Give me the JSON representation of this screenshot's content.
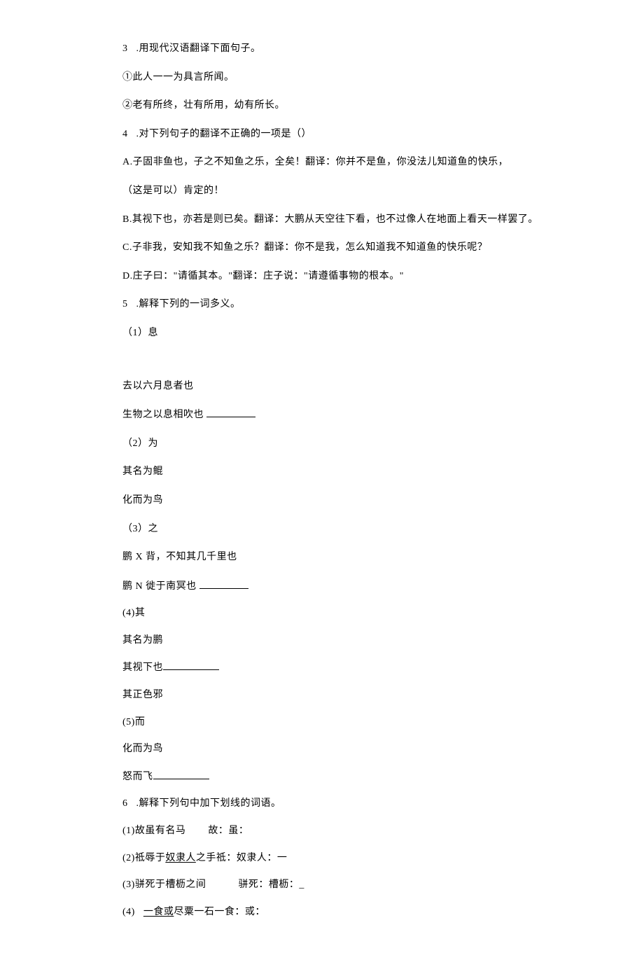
{
  "q3": {
    "num": "3",
    "prefix": ".用现代汉语翻译下面句子。",
    "line1": "①此人一一为具言所闻。",
    "line2": "②老有所终，壮有所用，幼有所长。"
  },
  "q4": {
    "num": "4",
    "prefix": ".对下列句子的翻译不正确的一项是（）",
    "optA": "A.子固非鱼也，子之不知鱼之乐，全矣！翻译：你并不是鱼，你没法儿知道鱼的快乐，",
    "optA2": "（这是可以）肯定的！",
    "optB": "B.其视下也，亦若是则已矣。翻译：大鹏从天空往下看，也不过像人在地面上看天一样罢了。",
    "optC": "C.子非我，安知我不知鱼之乐？翻译：你不是我，怎么知道我不知道鱼的快乐呢？",
    "optD": "D.庄子曰：\"请循其本。\"翻译：庄子说：\"请遵循事物的根本。\""
  },
  "q5": {
    "num": "5",
    "prefix": ".解释下列的一词多义。",
    "i1": "（1）息",
    "i1a": "去以六月息者也",
    "i1b": "生物之以息相吹也",
    "i2": "（2）为",
    "i2a": "其名为鲲",
    "i2b": "化而为鸟",
    "i3": "（3）之",
    "i3a": "鹏 X 背，不知其几千里也",
    "i3b": "鹏 N 徙于南冥也",
    "i4": "(4)其",
    "i4a": "其名为鹏",
    "i4b": "其视下也",
    "i4c": "其正色邪",
    "i5": "(5)而",
    "i5a": "化而为鸟",
    "i5b": "怒而飞"
  },
  "q6": {
    "num": "6",
    "prefix": ".解释下列句中加下划线的词语。",
    "line1_pre": "(1)故虽有名马",
    "line1_post": "故：虽：",
    "line2_pre": "(2)祗辱于",
    "line2_u": "奴隶人",
    "line2_post": "之手祗：奴隶人：一",
    "line3_pre": "(3)骈死于槽枥之间",
    "line3_post": "骈死：槽枥：_",
    "line4_pre": "(4)",
    "line4_u": "一食或",
    "line4_post": "尽粟一石一食：或："
  }
}
